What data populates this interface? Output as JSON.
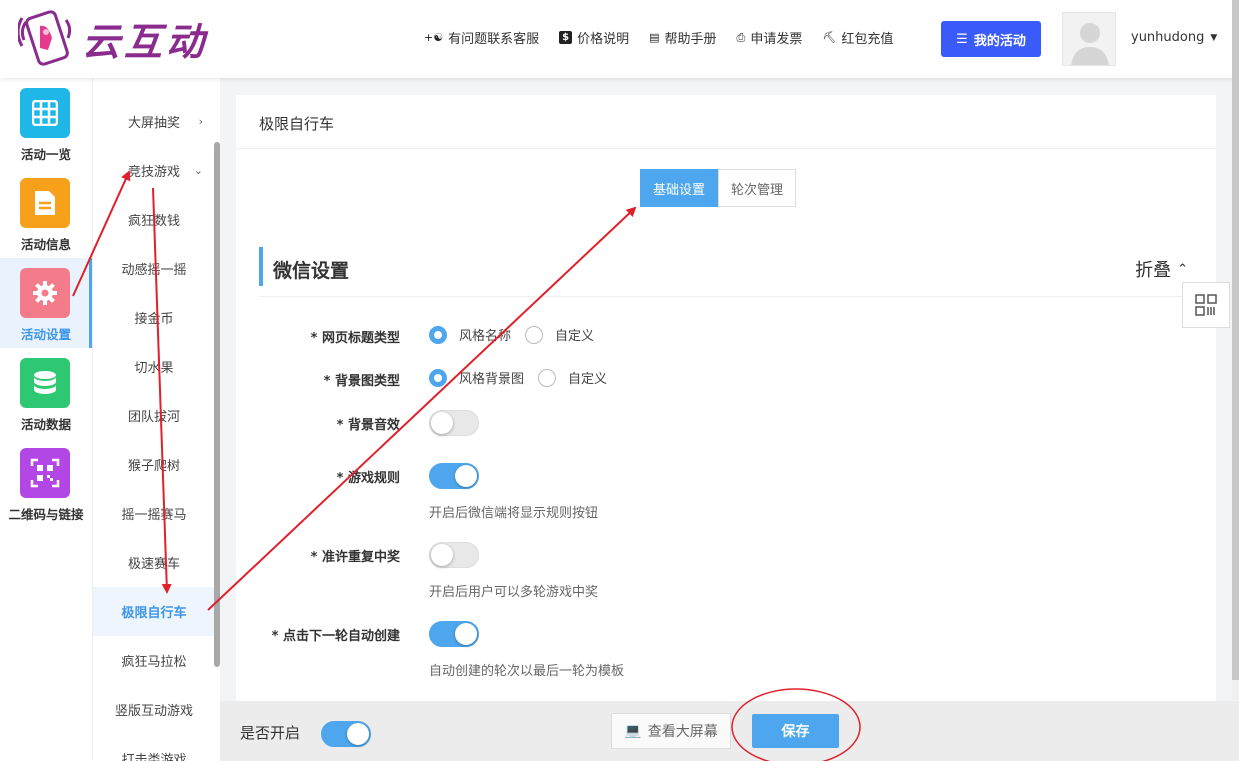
{
  "header": {
    "logo_text": "云互动",
    "nav": [
      {
        "icon": "add-user-icon",
        "label": "有问题联系客服"
      },
      {
        "icon": "dollar-icon",
        "label": "价格说明"
      },
      {
        "icon": "book-icon",
        "label": "帮助手册"
      },
      {
        "icon": "printer-icon",
        "label": "申请发票"
      },
      {
        "icon": "shield-check-icon",
        "label": "红包充值"
      }
    ],
    "my_activity": "我的活动",
    "username": "yunhudong"
  },
  "iconbar": [
    {
      "label": "活动一览",
      "icon": "grid-icon",
      "color": "#1fb6e8"
    },
    {
      "label": "活动信息",
      "icon": "document-icon",
      "color": "#f7a11a"
    },
    {
      "label": "活动设置",
      "icon": "gear-icon",
      "color": "#f37b8a",
      "active": true
    },
    {
      "label": "活动数据",
      "icon": "database-icon",
      "color": "#2ec872"
    },
    {
      "label": "二维码与链接",
      "icon": "qrcode-icon",
      "color": "#b347e6"
    }
  ],
  "submenu": {
    "items": [
      {
        "label": "大屏抽奖",
        "arrow": "›"
      },
      {
        "label": "竞技游戏",
        "arrow": "⌄"
      },
      {
        "label": "疯狂数钱"
      },
      {
        "label": "动感摇一摇"
      },
      {
        "label": "接金币"
      },
      {
        "label": "切水果"
      },
      {
        "label": "团队拔河"
      },
      {
        "label": "猴子爬树"
      },
      {
        "label": "摇一摇赛马"
      },
      {
        "label": "极速赛车"
      },
      {
        "label": "极限自行车",
        "active": true
      },
      {
        "label": "疯狂马拉松"
      },
      {
        "label": "竖版互动游戏"
      },
      {
        "label": "打击类游戏"
      }
    ]
  },
  "main": {
    "title": "极限自行车",
    "tabs": [
      {
        "label": "基础设置",
        "active": true
      },
      {
        "label": "轮次管理"
      }
    ],
    "section_title": "微信设置",
    "collapse_label": "折叠",
    "fields": {
      "page_title_type": {
        "label": "* 网页标题类型",
        "options": [
          "风格名称",
          "自定义"
        ],
        "selected": "风格名称"
      },
      "bg_type": {
        "label": "* 背景图类型",
        "options": [
          "风格背景图",
          "自定义"
        ],
        "selected": "风格背景图"
      },
      "bg_sound": {
        "label": "* 背景音效",
        "on": false
      },
      "game_rules": {
        "label": "* 游戏规则",
        "on": true,
        "hint": "开启后微信端将显示规则按钮"
      },
      "repeat_win": {
        "label": "* 准许重复中奖",
        "on": false,
        "hint": "开启后用户可以多轮游戏中奖"
      },
      "auto_create": {
        "label": "* 点击下一轮自动创建",
        "on": true,
        "hint": "自动创建的轮次以最后一轮为模板"
      }
    }
  },
  "footer": {
    "enabled_label": "是否开启",
    "enabled": true,
    "preview_label": "查看大屏幕",
    "save_label": "保存"
  },
  "colors": {
    "accent": "#4ea7ee",
    "primary_button": "#3a5af9",
    "annotation": "#e0202a"
  }
}
